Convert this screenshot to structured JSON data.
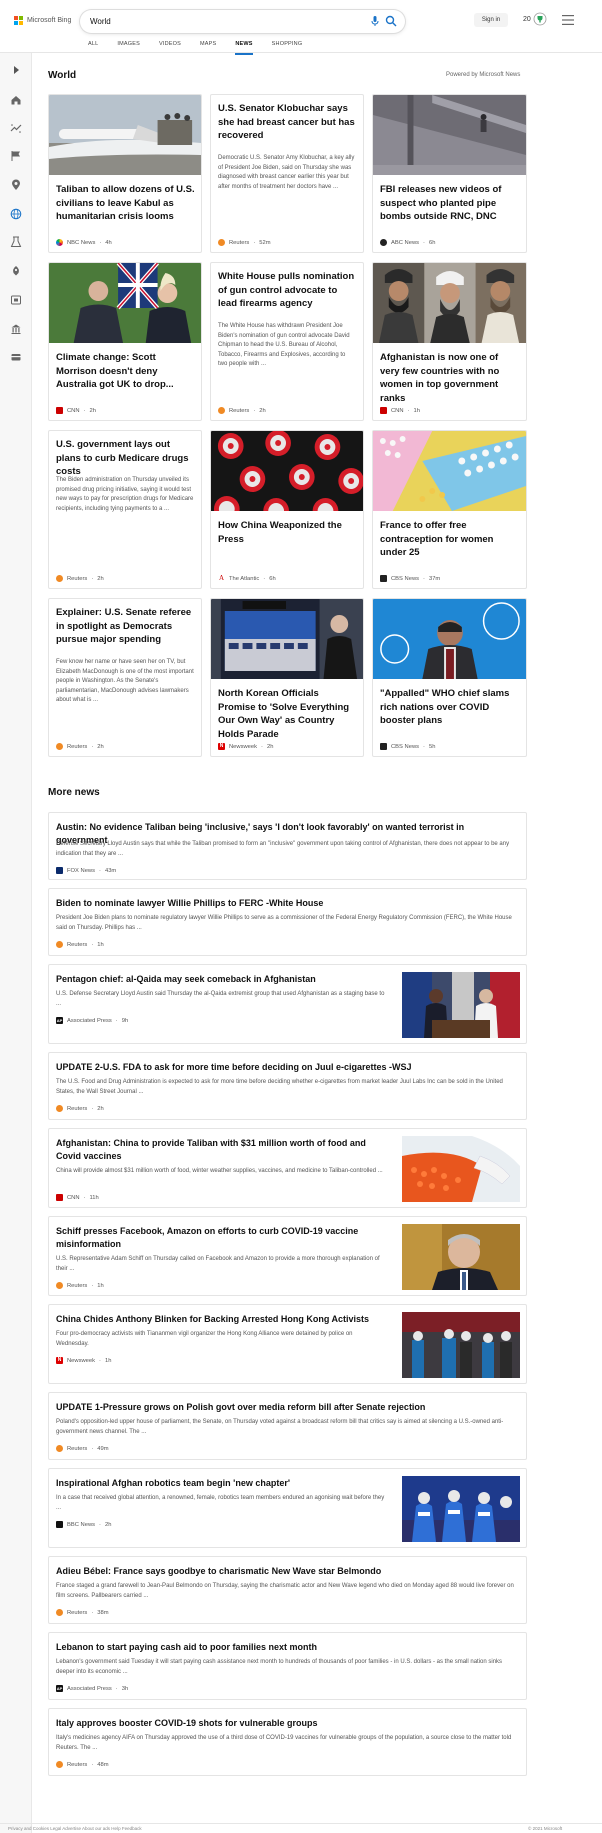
{
  "header": {
    "logo_text": "Microsoft Bing",
    "search_value": "World",
    "signin_label": "Sign in",
    "rewards_count": "20",
    "tabs": [
      "ALL",
      "IMAGES",
      "VIDEOS",
      "MAPS",
      "NEWS",
      "SHOPPING"
    ],
    "active_tab": "NEWS",
    "accent_color": "#1a73c8"
  },
  "sidebar": {
    "icons": [
      "expand-icon",
      "home-icon",
      "trending-icon",
      "us-flag-icon",
      "location-icon",
      "world-icon",
      "science-icon",
      "technology-icon",
      "entertainment-icon",
      "politics-icon",
      "business-icon"
    ]
  },
  "world": {
    "title": "World",
    "powered": "Powered by Microsoft News",
    "cards": [
      {
        "title": "Taliban to allow dozens of U.S. civilians to leave Kabul as humanitarian crisis looms",
        "source": "NBC News",
        "time": "4h",
        "snippet": ""
      },
      {
        "title": "U.S. Senator Klobuchar says she had breast cancer but has recovered",
        "source": "Reuters",
        "time": "52m",
        "snippet": "Democratic U.S. Senator Amy Klobuchar, a key ally of President Joe Biden, said on Thursday she was diagnosed with breast cancer earlier this year but after months of treatment her doctors have ..."
      },
      {
        "title": "FBI releases new videos of suspect who planted pipe bombs outside RNC, DNC",
        "source": "ABC News",
        "time": "6h",
        "snippet": ""
      },
      {
        "title": "Climate change: Scott Morrison doesn't deny Australia got UK to drop...",
        "source": "CNN",
        "time": "2h",
        "snippet": ""
      },
      {
        "title": "White House pulls nomination of gun control advocate to lead firearms agency",
        "source": "Reuters",
        "time": "2h",
        "snippet": "The White House has withdrawn President Joe Biden's nomination of gun control advocate David Chipman to head the U.S. Bureau of Alcohol, Tobacco, Firearms and Explosives, according to two people with ..."
      },
      {
        "title": "Afghanistan is now one of very few countries with no women in top government ranks",
        "source": "CNN",
        "time": "1h",
        "snippet": ""
      },
      {
        "title": "U.S. government lays out plans to curb Medicare drugs costs",
        "source": "Reuters",
        "time": "2h",
        "snippet": "The Biden administration on Thursday unveiled its promised drug pricing initiative, saying it would test new ways to pay for prescription drugs for Medicare recipients, including tying payments to a ..."
      },
      {
        "title": "How China Weaponized the Press",
        "source": "The Atlantic",
        "time": "6h",
        "snippet": ""
      },
      {
        "title": "France to offer free contraception for women under 25",
        "source": "CBS News",
        "time": "37m",
        "snippet": ""
      },
      {
        "title": "Explainer: U.S. Senate referee in spotlight as Democrats pursue major spending",
        "source": "Reuters",
        "time": "2h",
        "snippet": "Few know her name or have seen her on TV, but Elizabeth MacDonough is one of the most important people in Washington. As the Senate's parliamentarian, MacDonough advises lawmakers about what is ..."
      },
      {
        "title": "North Korean Officials Promise to 'Solve Everything Our Own Way' as Country Holds Parade",
        "source": "Newsweek",
        "time": "2h",
        "snippet": ""
      },
      {
        "title": "\"Appalled\" WHO chief slams rich nations over COVID booster plans",
        "source": "CBS News",
        "time": "5h",
        "snippet": ""
      }
    ]
  },
  "more_news": {
    "title": "More news",
    "items": [
      {
        "title": "Austin: No evidence Taliban being 'inclusive,' says 'I don't look favorably' on wanted terrorist in government",
        "snippet": "Defense Secretary Lloyd Austin says that while the Taliban promised to form an \"inclusive\" government upon taking control of Afghanistan, there does not appear to be any indication that they are ...",
        "source": "FOX News",
        "time": "43m"
      },
      {
        "title": "Biden to nominate lawyer Willie Phillips to FERC -White House",
        "snippet": "President Joe Biden plans to nominate regulatory lawyer Willie Phillips to serve as a commissioner of the Federal Energy Regulatory Commission (FERC), the White House said on Thursday. Phillips has ...",
        "source": "Reuters",
        "time": "1h"
      },
      {
        "title": "Pentagon chief: al-Qaida may seek comeback in Afghanistan",
        "snippet": "U.S. Defense Secretary Lloyd Austin said Thursday the al-Qaida extremist group that used Afghanistan as a staging base to ...",
        "source": "Associated Press",
        "time": "9h"
      },
      {
        "title": "UPDATE 2-U.S. FDA to ask for more time before deciding on Juul e-cigarettes -WSJ",
        "snippet": "The U.S. Food and Drug Administration is expected to ask for more time before deciding whether e-cigarettes from market leader Juul Labs Inc can be sold in the United States, the Wall Street Journal ...",
        "source": "Reuters",
        "time": "2h"
      },
      {
        "title": "Afghanistan: China to provide Taliban with $31 million worth of food and Covid vaccines",
        "snippet": "China will provide almost $31 million worth of food, winter weather supplies, vaccines, and medicine to Taliban-controlled ...",
        "source": "CNN",
        "time": "11h"
      },
      {
        "title": "Schiff presses Facebook, Amazon on efforts to curb COVID-19 vaccine misinformation",
        "snippet": "U.S. Representative Adam Schiff on Thursday called on Facebook and Amazon to provide a more thorough explanation of their ...",
        "source": "Reuters",
        "time": "1h"
      },
      {
        "title": "China Chides Anthony Blinken for Backing Arrested Hong Kong Activists",
        "snippet": "Four pro-democracy activists with Tiananmen vigil organizer the Hong Kong Alliance were detained by police on Wednesday.",
        "source": "Newsweek",
        "time": "1h"
      },
      {
        "title": "UPDATE 1-Pressure grows on Polish govt over media reform bill after Senate rejection",
        "snippet": "Poland's opposition-led upper house of parliament, the Senate, on Thursday voted against a broadcast reform bill that critics say is aimed at silencing a U.S.-owned anti-government news channel. The ...",
        "source": "Reuters",
        "time": "49m"
      },
      {
        "title": "Inspirational Afghan robotics team begin 'new chapter'",
        "snippet": "In a case that received global attention, a renowned, female, robotics team members endured an agonising wait before they ...",
        "source": "BBC News",
        "time": "2h"
      },
      {
        "title": "Adieu Bébel: France says goodbye to charismatic New Wave star Belmondo",
        "snippet": "France staged a grand farewell to Jean-Paul Belmondo on Thursday, saying the charismatic actor and New Wave legend who died on Monday aged 88 would live forever on film screens. Pallbearers carried ...",
        "source": "Reuters",
        "time": "38m"
      },
      {
        "title": "Lebanon to start paying cash aid to poor families next month",
        "snippet": "Lebanon's government said Tuesday it will start paying cash assistance next month to hundreds of thousands of poor families - in U.S. dollars - as the small nation sinks deeper into its economic ...",
        "source": "Associated Press",
        "time": "3h"
      },
      {
        "title": "Italy approves booster COVID-19 shots for vulnerable groups",
        "snippet": "Italy's medicines agency AIFA on Thursday approved the use of a third dose of COVID-19 vaccines for vulnerable groups of the population, a source close to the matter told Reuters. The ...",
        "source": "Reuters",
        "time": "48m"
      }
    ]
  },
  "footer": {
    "left": "Privacy and Cookies   Legal   Advertise   About our ads   Help   Feedback",
    "right": "© 2021 Microsoft"
  }
}
